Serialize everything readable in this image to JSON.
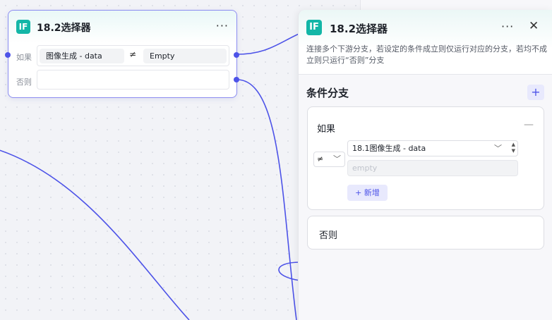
{
  "node": {
    "badge": "IF",
    "title": "18.2选择器",
    "more": "···",
    "if_label": "如果",
    "else_label": "否则",
    "condition": {
      "left": "图像生成  -  data",
      "operator": "≠",
      "right": "Empty"
    }
  },
  "panel": {
    "badge": "IF",
    "title": "18.2选择器",
    "more": "···",
    "close": "✕",
    "description": "连接多个下游分支，若设定的条件成立则仅运行对应的分支，若均不成立则只运行“否则”分支",
    "section_title": "条件分支",
    "add_branch": "+",
    "if_card": {
      "label": "如果",
      "collapse": "—",
      "operator": "≠",
      "variable": "18.1图像生成 - data",
      "value_placeholder": "empty",
      "add_condition": "+ 新增"
    },
    "else_card": {
      "label": "否则"
    }
  },
  "colors": {
    "accent": "#4d53e8",
    "badge": "#13b6a7",
    "node_border": "#8b8cf0"
  }
}
